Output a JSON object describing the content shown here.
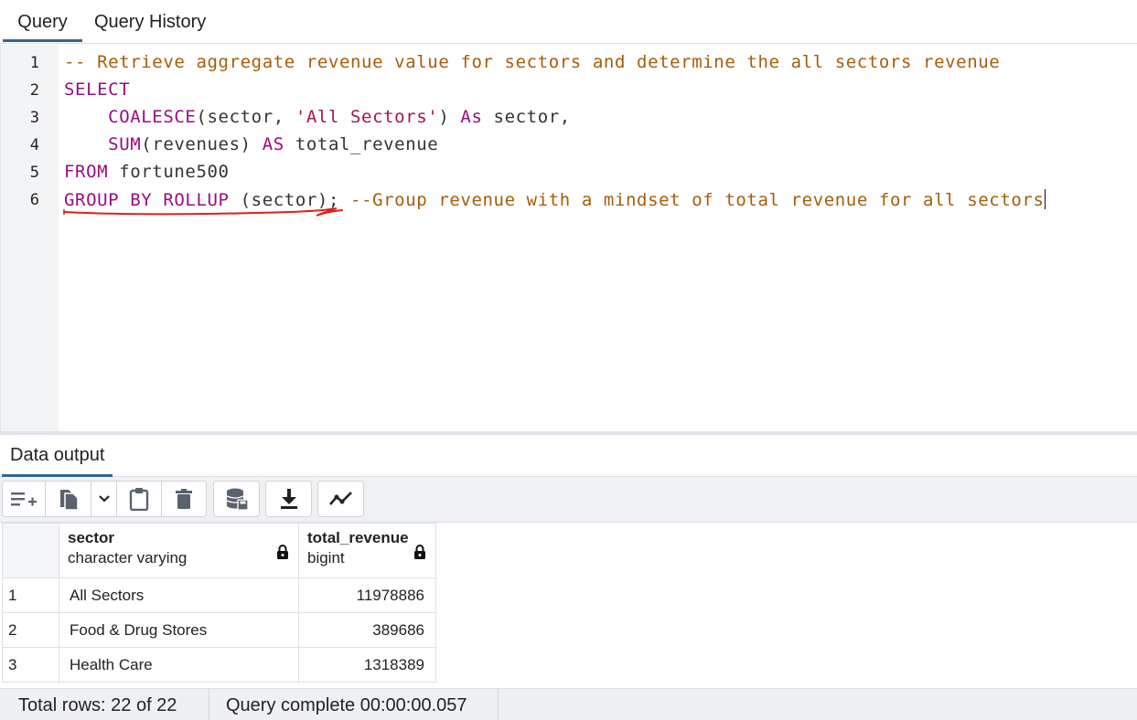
{
  "tabs": {
    "query": "Query",
    "query_history": "Query History"
  },
  "editor": {
    "line_numbers": [
      "1",
      "2",
      "3",
      "4",
      "5",
      "6"
    ],
    "line1": {
      "comment": "-- Retrieve aggregate revenue value for sectors and determine the all sectors revenue"
    },
    "line2": {
      "kw": "SELECT"
    },
    "line3": {
      "indent": "    ",
      "fn": "COALESCE",
      "open": "(sector, ",
      "str": "'All Sectors'",
      "close": ") ",
      "kw": "As",
      "rest": " sector,"
    },
    "line4": {
      "indent": "    ",
      "fn": "SUM",
      "args": "(revenues) ",
      "kw": "AS",
      "rest": " total_revenue"
    },
    "line5": {
      "kw": "FROM",
      "rest": " fortune500"
    },
    "line6": {
      "kw": "GROUP BY ROLLUP",
      "args": " (sector); ",
      "comment": "--Group revenue with a mindset of total revenue for all sectors"
    }
  },
  "output": {
    "tab_label": "Data output",
    "toolbar": {
      "icons": [
        "add-row-icon",
        "copy-icon",
        "chevron-down-icon",
        "paste-icon",
        "delete-icon",
        "save-data-icon",
        "download-icon",
        "graph-icon"
      ]
    },
    "columns": [
      {
        "name": "sector",
        "type": "character varying"
      },
      {
        "name": "total_revenue",
        "type": "bigint"
      }
    ],
    "rows": [
      {
        "num": "1",
        "sector": "All Sectors",
        "total_revenue": "11978886"
      },
      {
        "num": "2",
        "sector": "Food & Drug Stores",
        "total_revenue": "389686"
      },
      {
        "num": "3",
        "sector": "Health Care",
        "total_revenue": "1318389"
      }
    ]
  },
  "status": {
    "total_rows": "Total rows: 22 of 22",
    "query_complete": "Query complete 00:00:00.057"
  },
  "colors": {
    "keyword": "#9a0c7f",
    "string": "#a3154d",
    "comment": "#a55d0b",
    "active_tab_underline": "#326690",
    "error_squiggle": "#e0201a"
  }
}
